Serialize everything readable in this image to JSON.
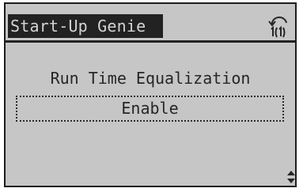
{
  "header": {
    "title": "Start-Up Genie",
    "nav_icon": "back-arrow-icon"
  },
  "parameter": {
    "label": "Run Time Equalization",
    "value": "Enable"
  },
  "scroll_icon": "up-down-arrows-icon",
  "colors": {
    "screen_background": "#c6c6c6",
    "text_dark": "#262626",
    "title_background": "#222222",
    "title_text": "#d4d4d4"
  }
}
